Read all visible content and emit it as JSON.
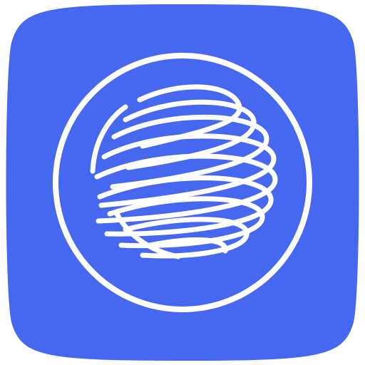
{
  "app_icon": {
    "name": "globe-logo-app-icon",
    "icon": "swirl-globe-icon",
    "colors": {
      "background": "#ffffff",
      "tile": "#4668EE",
      "mark": "#ffffff"
    }
  }
}
